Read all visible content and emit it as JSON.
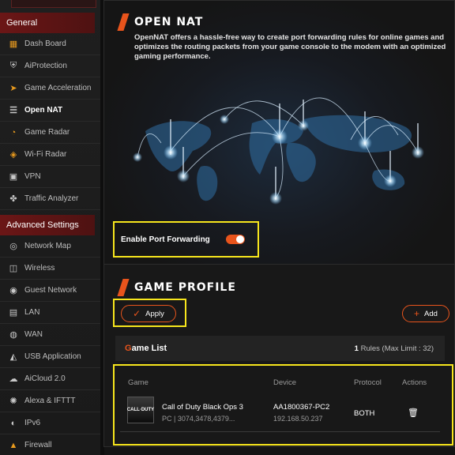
{
  "sidebar": {
    "sections": [
      {
        "title": "General"
      },
      {
        "title": "Advanced Settings"
      }
    ],
    "items": [
      {
        "label": "Dash Board",
        "icon": "dashboard-icon",
        "glyph": "▦"
      },
      {
        "label": "AiProtection",
        "icon": "aiprotection-icon",
        "glyph": "⛨"
      },
      {
        "label": "Game Acceleration",
        "icon": "rocket-icon",
        "glyph": "➤"
      },
      {
        "label": "Open NAT",
        "icon": "open-nat-icon",
        "glyph": "☰",
        "active": true
      },
      {
        "label": "Game Radar",
        "icon": "radar-icon",
        "glyph": "◔"
      },
      {
        "label": "Wi-Fi Radar",
        "icon": "wifi-radar-icon",
        "glyph": "◈"
      },
      {
        "label": "VPN",
        "icon": "vpn-icon",
        "glyph": "▣"
      },
      {
        "label": "Traffic Analyzer",
        "icon": "traffic-analyzer-icon",
        "glyph": "✤"
      },
      {
        "label": "Network Map",
        "icon": "network-map-icon",
        "glyph": "◎"
      },
      {
        "label": "Wireless",
        "icon": "wireless-icon",
        "glyph": "◫"
      },
      {
        "label": "Guest Network",
        "icon": "guest-network-icon",
        "glyph": "◉"
      },
      {
        "label": "LAN",
        "icon": "lan-icon",
        "glyph": "▤"
      },
      {
        "label": "WAN",
        "icon": "wan-icon",
        "glyph": "◍"
      },
      {
        "label": "USB Application",
        "icon": "usb-icon",
        "glyph": "◭"
      },
      {
        "label": "AiCloud 2.0",
        "icon": "cloud-icon",
        "glyph": "☁"
      },
      {
        "label": "Alexa & IFTTT",
        "icon": "alexa-icon",
        "glyph": "✺"
      },
      {
        "label": "IPv6",
        "icon": "ipv6-icon",
        "glyph": "◐"
      },
      {
        "label": "Firewall",
        "icon": "firewall-icon",
        "glyph": "▲"
      }
    ]
  },
  "open_nat": {
    "title": "OPEN NAT",
    "description": "OpenNAT offers a hassle-free way to create port forwarding rules for online games and optimizes the routing packets from your game console to the modem with an optimized gaming performance.",
    "toggle_label": "Enable Port Forwarding",
    "toggle_on": true
  },
  "game_profile": {
    "title": "GAME PROFILE",
    "apply_label": "Apply",
    "add_label": "Add",
    "list_title_first": "G",
    "list_title_rest": "ame List",
    "rule_count": "1",
    "rule_text": "Rules (Max Limit : 32)",
    "columns": [
      "Game",
      "Device",
      "Protocol",
      "Actions"
    ],
    "rows": [
      {
        "thumb_text": "CALL·DUTY",
        "game_name": "Call of Duty Black Ops 3",
        "game_sub": "PC | 3074,3478,4379...",
        "device_name": "AA1800367-PC2",
        "device_ip": "192.168.50.237",
        "protocol": "BOTH"
      }
    ]
  },
  "colors": {
    "accent": "#e8541c",
    "highlight": "#f7e61c",
    "section_header": "#6b1616"
  }
}
